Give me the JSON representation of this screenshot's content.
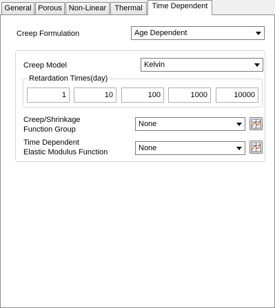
{
  "tabs": [
    {
      "label": "General"
    },
    {
      "label": "Porous"
    },
    {
      "label": "Non-Linear"
    },
    {
      "label": "Thermal"
    },
    {
      "label": "Time Dependent"
    }
  ],
  "active_tab": "Time Dependent",
  "creep_formulation": {
    "label": "Creep Formulation",
    "value": "Age Dependent"
  },
  "creep_model": {
    "label": "Creep Model",
    "value": "Kelvin"
  },
  "retardation": {
    "title": "Retardation Times(day)",
    "values": [
      "1",
      "10",
      "100",
      "1000",
      "10000"
    ]
  },
  "creep_shrinkage": {
    "label_line1": "Creep/Shrinkage",
    "label_line2": "Function Group",
    "value": "None",
    "button_icon": "function-graph-icon"
  },
  "elastic_modulus": {
    "label_line1": "Time Dependent",
    "label_line2": "Elastic Modulus Function",
    "value": "None",
    "button_icon": "function-graph-icon"
  }
}
